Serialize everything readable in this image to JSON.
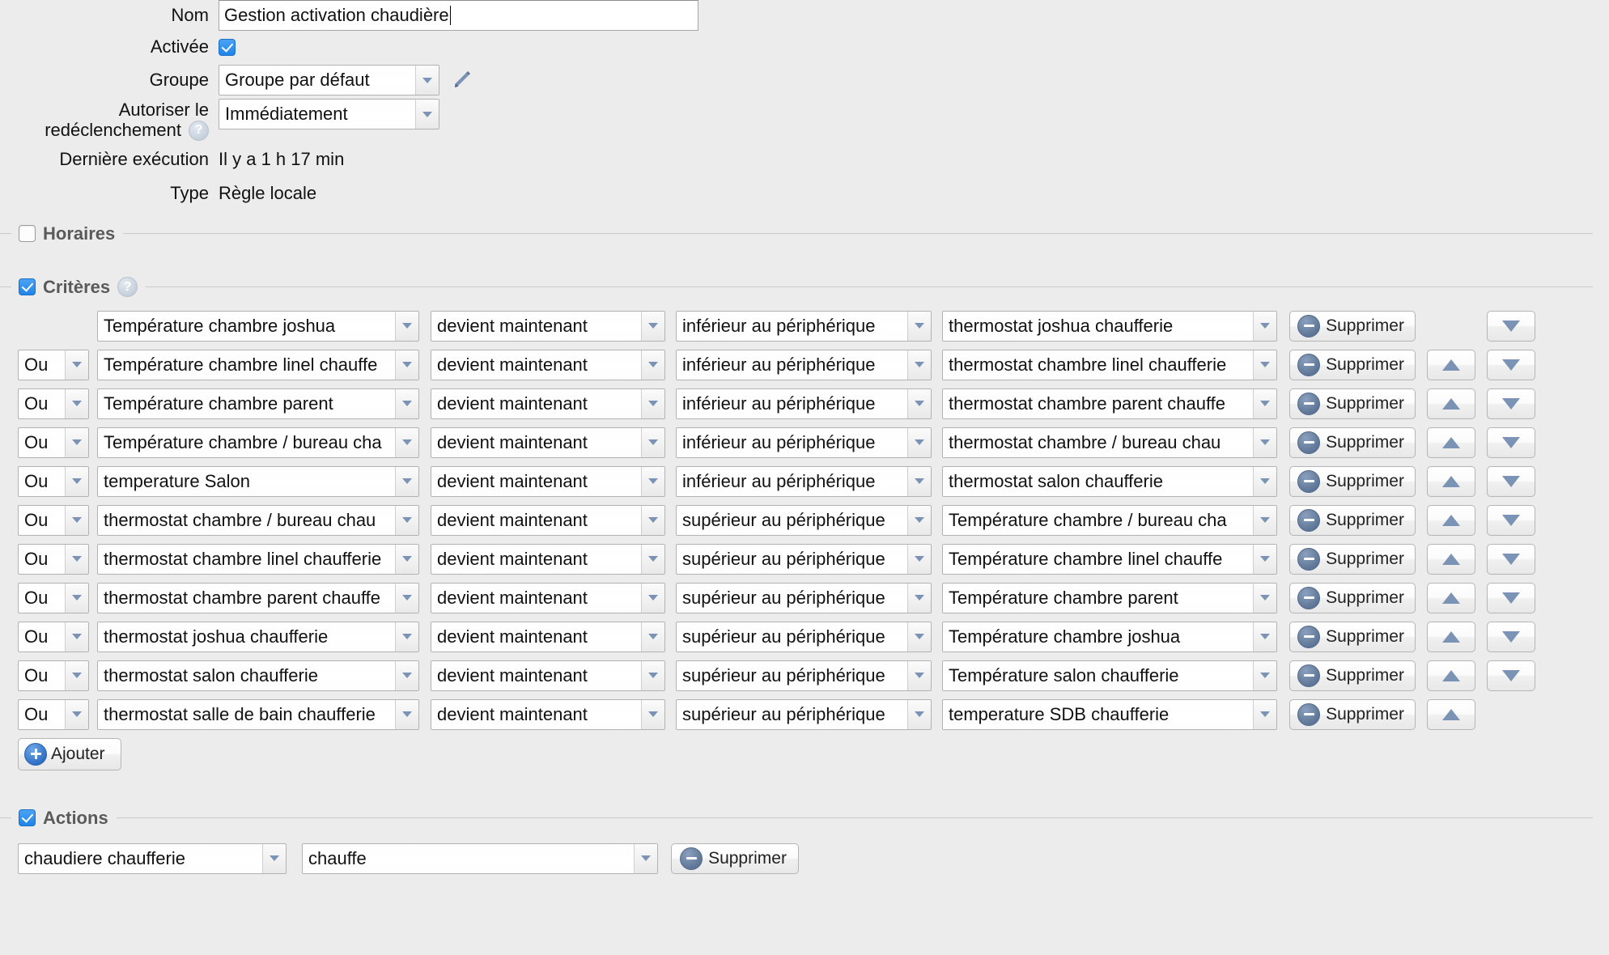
{
  "form": {
    "name_label": "Nom",
    "name_value": "Gestion activation chaudière",
    "enabled_label": "Activée",
    "group_label": "Groupe",
    "group_value": "Groupe par défaut",
    "retrigger_label_line1": "Autoriser le",
    "retrigger_label_line2": "redéclenchement",
    "retrigger_value": "Immédiatement",
    "last_run_label": "Dernière exécution",
    "last_run_value": "Il y a 1 h 17 min",
    "type_label": "Type",
    "type_value": "Règle locale",
    "help_glyph": "?",
    "edit_icon": "pencil-icon"
  },
  "sections": {
    "schedule_title": "Horaires",
    "criteria_title": "Critères",
    "actions_title": "Actions"
  },
  "buttons": {
    "delete_label": "Supprimer",
    "add_label": "Ajouter",
    "move_up_icon": "arrow-up-icon",
    "move_down_icon": "arrow-down-icon"
  },
  "criteria": {
    "rows": [
      {
        "join": "",
        "source": "Température chambre joshua",
        "operator": "devient maintenant",
        "comparator": "inférieur au périphérique",
        "target": "thermostat joshua chaufferie",
        "has_up": false,
        "has_down": true
      },
      {
        "join": "Ou",
        "source": "Température chambre linel chauffe",
        "operator": "devient maintenant",
        "comparator": "inférieur au périphérique",
        "target": "thermostat chambre linel chaufferie",
        "has_up": true,
        "has_down": true
      },
      {
        "join": "Ou",
        "source": "Température chambre parent",
        "operator": "devient maintenant",
        "comparator": "inférieur au périphérique",
        "target": "thermostat chambre parent chauffe",
        "has_up": true,
        "has_down": true
      },
      {
        "join": "Ou",
        "source": "Température chambre / bureau cha",
        "operator": "devient maintenant",
        "comparator": "inférieur au périphérique",
        "target": "thermostat chambre / bureau chau",
        "has_up": true,
        "has_down": true
      },
      {
        "join": "Ou",
        "source": "temperature Salon",
        "operator": "devient maintenant",
        "comparator": "inférieur au périphérique",
        "target": "thermostat salon chaufferie",
        "has_up": true,
        "has_down": true
      },
      {
        "join": "Ou",
        "source": "thermostat chambre / bureau chau",
        "operator": "devient maintenant",
        "comparator": "supérieur au périphérique",
        "target": "Température chambre / bureau cha",
        "has_up": true,
        "has_down": true
      },
      {
        "join": "Ou",
        "source": "thermostat chambre linel chaufferie",
        "operator": "devient maintenant",
        "comparator": "supérieur au périphérique",
        "target": "Température chambre linel chauffe",
        "has_up": true,
        "has_down": true
      },
      {
        "join": "Ou",
        "source": "thermostat chambre parent chauffe",
        "operator": "devient maintenant",
        "comparator": "supérieur au périphérique",
        "target": "Température chambre parent",
        "has_up": true,
        "has_down": true
      },
      {
        "join": "Ou",
        "source": "thermostat joshua chaufferie",
        "operator": "devient maintenant",
        "comparator": "supérieur au périphérique",
        "target": "Température chambre joshua",
        "has_up": true,
        "has_down": true
      },
      {
        "join": "Ou",
        "source": "thermostat salon chaufferie",
        "operator": "devient maintenant",
        "comparator": "supérieur au périphérique",
        "target": "Température salon chaufferie",
        "has_up": true,
        "has_down": true
      },
      {
        "join": "Ou",
        "source": "thermostat salle de bain chaufferie",
        "operator": "devient maintenant",
        "comparator": "supérieur au périphérique",
        "target": "temperature SDB chaufferie",
        "has_up": true,
        "has_down": false
      }
    ]
  },
  "actions": {
    "device": "chaudiere chaufferie",
    "command": "chauffe",
    "delete_label": "Supprimer"
  },
  "colors": {
    "accent_blue": "#2f84e8",
    "page_bg": "#ececec",
    "chevron": "#7b93b4",
    "section_title": "#5a5a5a"
  }
}
